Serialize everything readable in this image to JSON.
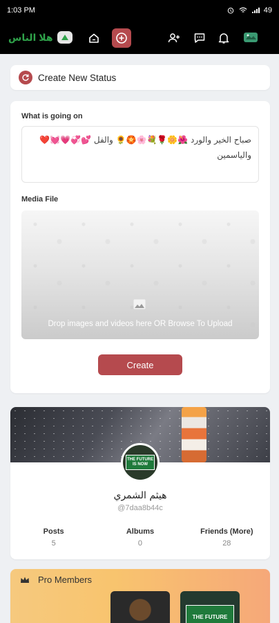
{
  "status_bar": {
    "time": "1:03 PM",
    "battery": "49"
  },
  "app_bar": {
    "logo_text": "هلا الناس",
    "icons": [
      "home-icon",
      "plus-circle-icon",
      "add-user-icon",
      "messages-icon",
      "bell-icon",
      "profile-avatar"
    ]
  },
  "title_card": {
    "title": "Create New Status"
  },
  "form": {
    "status_label": "What is going on",
    "status_text": "صباح الخير والورد 🌺🌼🌹💐🌸🏵️🌻 والفل 💕💞💗💓❤️ والياسمين",
    "media_label": "Media File",
    "drop_text": "Drop images and videos here OR Browse To Upload",
    "create_label": "Create"
  },
  "profile": {
    "name": "هيثم الشمري",
    "handle": "@7daa8b44c",
    "avatar_sign": "THE FUTURE IS NOW",
    "stats": [
      {
        "label": "Posts",
        "value": "5"
      },
      {
        "label": "Albums",
        "value": "0"
      },
      {
        "label": "Friends (More)",
        "value": "28"
      }
    ]
  },
  "pro_members": {
    "title": "Pro Members",
    "second_thumb_text": "THE FUTURE"
  },
  "colors": {
    "accent": "#b54a4e",
    "logo_green": "#2fa24a",
    "pro_gradient_start": "#f6c97e",
    "pro_gradient_end": "#f6a879"
  }
}
